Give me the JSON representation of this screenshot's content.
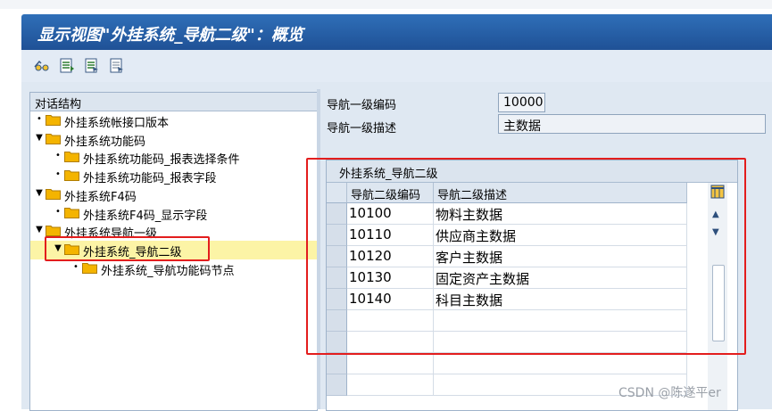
{
  "window": {
    "title": "显示视图\"外挂系统_导航二级\"：概览"
  },
  "toolbar": {
    "icons": [
      "glasses-icon",
      "display-icon",
      "select-all-icon",
      "deselect-icon"
    ]
  },
  "tree": {
    "header": "对话结构",
    "nodes": [
      {
        "label": "外挂系统帐接口版本",
        "level": 0,
        "expand": "leaf"
      },
      {
        "label": "外挂系统功能码",
        "level": 0,
        "expand": "open"
      },
      {
        "label": "外挂系统功能码_报表选择条件",
        "level": 1,
        "expand": "leaf"
      },
      {
        "label": "外挂系统功能码_报表字段",
        "level": 1,
        "expand": "leaf"
      },
      {
        "label": "外挂系统F4码",
        "level": 0,
        "expand": "open"
      },
      {
        "label": "外挂系统F4码_显示字段",
        "level": 1,
        "expand": "leaf"
      },
      {
        "label": "外挂系统导航一级",
        "level": 0,
        "expand": "open"
      },
      {
        "label": "外挂系统_导航二级",
        "level": 1,
        "expand": "open",
        "selected": true
      },
      {
        "label": "外挂系统_导航功能码节点",
        "level": 2,
        "expand": "leaf"
      }
    ]
  },
  "form": {
    "code_label": "导航一级编码",
    "code_value": "10000",
    "desc_label": "导航一级描述",
    "desc_value": "主数据"
  },
  "grid": {
    "title": "外挂系统_导航二级",
    "columns": [
      "导航二级编码",
      "导航二级描述"
    ],
    "rows": [
      [
        "10100",
        "物料主数据"
      ],
      [
        "10110",
        "供应商主数据"
      ],
      [
        "10120",
        "客户主数据"
      ],
      [
        "10130",
        "固定资产主数据"
      ],
      [
        "10140",
        "科目主数据"
      ]
    ]
  },
  "colors": {
    "title_bar": "#1f5196",
    "highlight": "#fcf4a6",
    "annotation": "#e31d1d",
    "folder": "#f4b400"
  },
  "watermark": "CSDN @陈遂平er"
}
